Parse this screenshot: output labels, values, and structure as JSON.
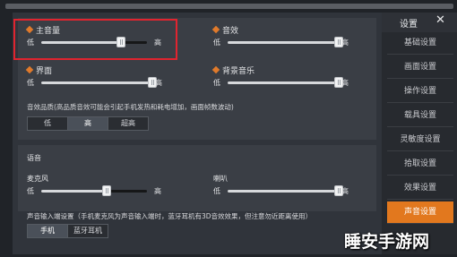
{
  "header": {
    "title": "设置"
  },
  "sidebar": {
    "items": [
      {
        "label": "基础设置",
        "active": false
      },
      {
        "label": "画面设置",
        "active": false
      },
      {
        "label": "操作设置",
        "active": false
      },
      {
        "label": "载具设置",
        "active": false
      },
      {
        "label": "灵敏度设置",
        "active": false
      },
      {
        "label": "拾取设置",
        "active": false
      },
      {
        "label": "效果设置",
        "active": false
      },
      {
        "label": "声音设置",
        "active": true
      }
    ]
  },
  "sliders": {
    "master": {
      "label": "主音量",
      "low": "低",
      "high": "高",
      "value": 0.75
    },
    "sfx": {
      "label": "音效",
      "low": "低",
      "high": "高",
      "value": 1.0
    },
    "ui": {
      "label": "界面",
      "low": "低",
      "high": "高",
      "value": 1.0
    },
    "bgm": {
      "label": "背景音乐",
      "low": "低",
      "high": "高",
      "value": 1.0
    },
    "mic": {
      "label": "麦克风",
      "low": "低",
      "high": "高",
      "value": 0.62
    },
    "speaker": {
      "label": "喇叭",
      "low": "低",
      "high": "高",
      "value": 1.0
    }
  },
  "quality": {
    "note": "音效品质(高品质音效可能会引起手机发热和耗电增加，画面帧数波动)",
    "options": [
      "低",
      "高",
      "超高"
    ],
    "selected": "高"
  },
  "voice": {
    "section_label": "语音",
    "input_note": "声音输入端设置（手机麦克风为声音输入端时，蓝牙耳机有3D音效效果，但注意勿近距离使用）",
    "input_options": [
      "手机",
      "蓝牙耳机"
    ],
    "selected": "手机"
  },
  "watermark": "睡安手游网",
  "colors": {
    "accent": "#e2781e",
    "highlight_box": "#e0242f"
  }
}
